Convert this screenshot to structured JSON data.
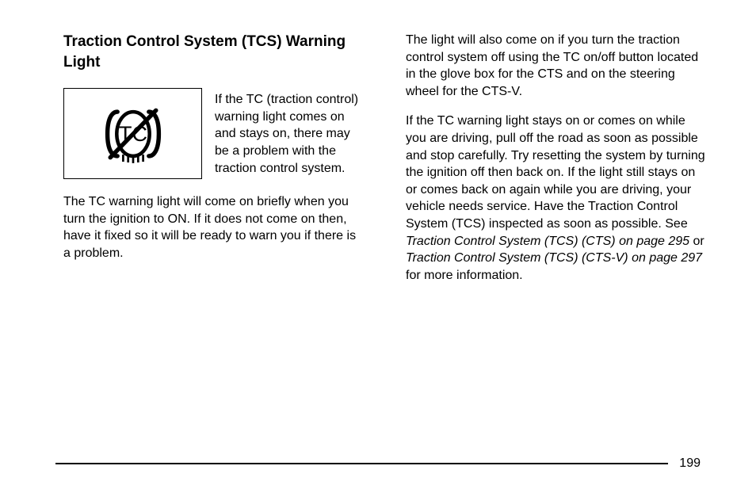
{
  "heading": "Traction Control System (TCS) Warning Light",
  "icon_name": "traction-control-icon",
  "icon_caption": "If the TC (traction control) warning light comes on and stays on, there may be a problem with the traction control system.",
  "left_para": "The TC warning light will come on briefly when you turn the ignition to ON. If it does not come on then, have it fixed so it will be ready to warn you if there is a problem.",
  "right_para1": "The light will also come on if you turn the traction control system off using the TC on/off button located in the glove box for the CTS and on the steering wheel for the CTS-V.",
  "right_para2_start": "If the TC warning light stays on or comes on while you are driving, pull off the road as soon as possible and stop carefully. Try resetting the system by turning the ignition off then back on. If the light still stays on or comes back on again while you are driving, your vehicle needs service. Have the Traction Control System (TCS) inspected as soon as possible. See ",
  "right_para2_ref1": "Traction Control System (TCS) (CTS) on page 295",
  "right_para2_or": " or ",
  "right_para2_ref2": "Traction Control System (TCS) (CTS-V) on page 297",
  "right_para2_end": " for more information.",
  "page_number": "199"
}
